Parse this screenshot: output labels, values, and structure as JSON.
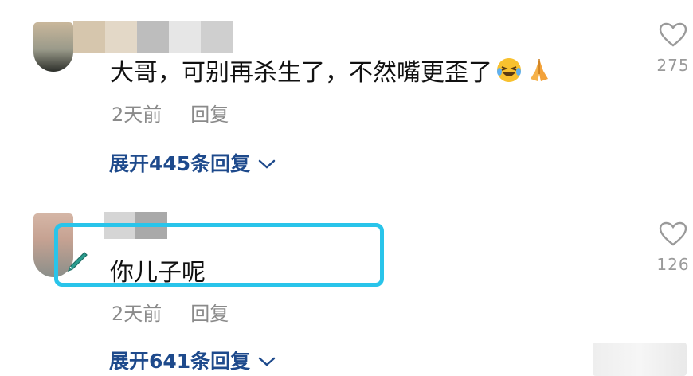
{
  "comments": [
    {
      "text": "大哥，可别再杀生了，不然嘴更歪了",
      "emojis": [
        "laughing-crying-face-icon",
        "folded-hands-icon"
      ],
      "time": "2天前",
      "reply_label": "回复",
      "expand_label": "展开445条回复",
      "likes": "275"
    },
    {
      "text": "你儿子呢",
      "time": "2天前",
      "reply_label": "回复",
      "expand_label": "展开641条回复",
      "likes": "126"
    }
  ],
  "colors": {
    "link": "#1e4a8c",
    "meta": "#8a8a8a",
    "highlight": "#29c4ea"
  }
}
